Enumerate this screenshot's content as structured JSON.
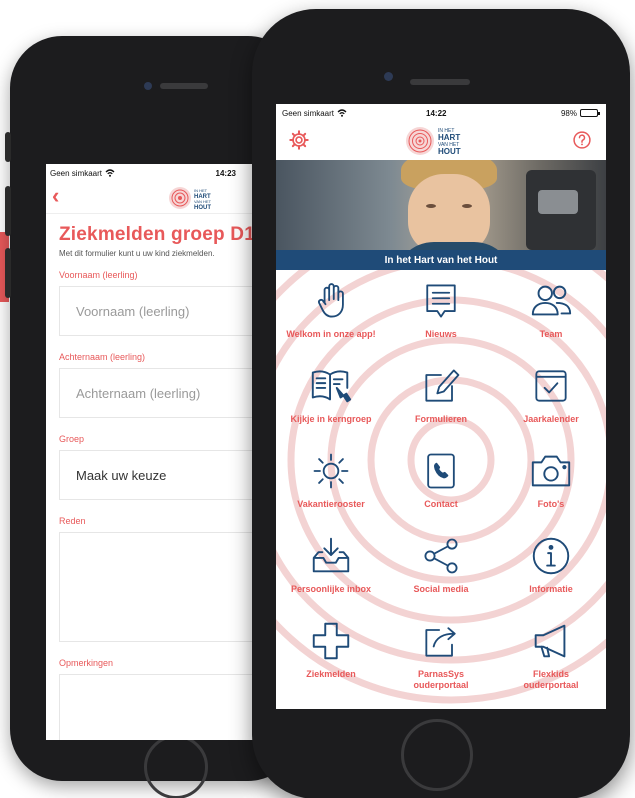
{
  "colors": {
    "accent": "#e8595a",
    "navy": "#1f4b78"
  },
  "back_phone": {
    "status": {
      "carrier": "Geen simkaart",
      "time": "14:23"
    },
    "form": {
      "title": "Ziekmelden groep D1/",
      "subtitle": "Met dit formulier kunt u uw kind ziekmelden.",
      "fields": [
        {
          "label": "Voornaam (leerling)",
          "placeholder": "Voornaam (leerling)"
        },
        {
          "label": "Achternaam (leerling)",
          "placeholder": "Achternaam (leerling)"
        },
        {
          "label": "Groep",
          "value": "Maak uw keuze"
        },
        {
          "label": "Reden"
        },
        {
          "label": "Opmerkingen"
        }
      ]
    }
  },
  "front_phone": {
    "status": {
      "carrier": "Geen simkaart",
      "time": "14:22",
      "battery": "98%"
    },
    "battery_level": 0.98,
    "logo": {
      "line1": "IN HET",
      "line2": "HART",
      "line3": "VAN HET",
      "line4": "HOUT"
    },
    "hero_caption": "In het Hart van het Hout",
    "menu": [
      {
        "label": "Welkom in onze app!",
        "icon": "hand-icon"
      },
      {
        "label": "Nieuws",
        "icon": "news-icon"
      },
      {
        "label": "Team",
        "icon": "team-icon"
      },
      {
        "label": "Kijkje in kerngroep",
        "icon": "book-icon"
      },
      {
        "label": "Formulieren",
        "icon": "form-icon"
      },
      {
        "label": "Jaarkalender",
        "icon": "calendar-icon"
      },
      {
        "label": "Vakantierooster",
        "icon": "sun-icon"
      },
      {
        "label": "Contact",
        "icon": "phone-icon"
      },
      {
        "label": "Foto's",
        "icon": "camera-icon"
      },
      {
        "label": "Persoonlijke inbox",
        "icon": "inbox-icon"
      },
      {
        "label": "Social media",
        "icon": "share-icon"
      },
      {
        "label": "Informatie",
        "icon": "info-icon"
      },
      {
        "label": "Ziekmelden",
        "icon": "cross-icon"
      },
      {
        "label": "ParnasSys\nouderportaal",
        "icon": "export-icon"
      },
      {
        "label": "Flexkids\nouderportaal",
        "icon": "megaphone-icon"
      }
    ]
  }
}
